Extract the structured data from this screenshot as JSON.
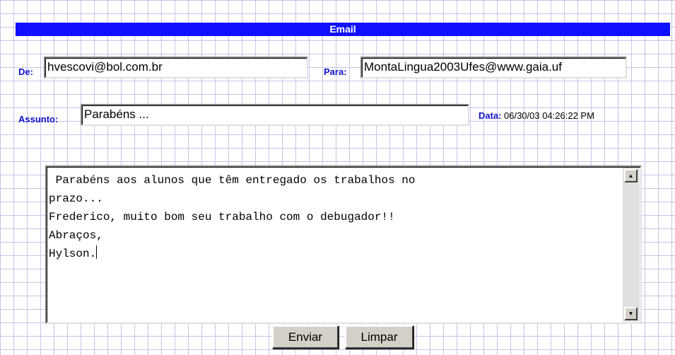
{
  "header": {
    "title": "Email"
  },
  "from": {
    "label": "De:",
    "value": "hvescovi@bol.com.br"
  },
  "to": {
    "label": "Para:",
    "value": "MontaLingua2003Ufes@www.gaia.uf"
  },
  "subject": {
    "label": "Assunto:",
    "value": "Parabéns ..."
  },
  "date": {
    "label": "Data:",
    "value": "06/30/03 04:26:22 PM"
  },
  "message": {
    "lines": [
      " Parabéns aos alunos que têm entregado os trabalhos no",
      "prazo...",
      "Frederico, muito bom seu trabalho com o debugador!!",
      "Abraços,",
      "Hylson."
    ]
  },
  "buttons": {
    "send": "Enviar",
    "clear": "Limpar"
  },
  "colors": {
    "accent": "#1010ff",
    "label": "#1010cc",
    "grid": "#c9c3e6"
  }
}
